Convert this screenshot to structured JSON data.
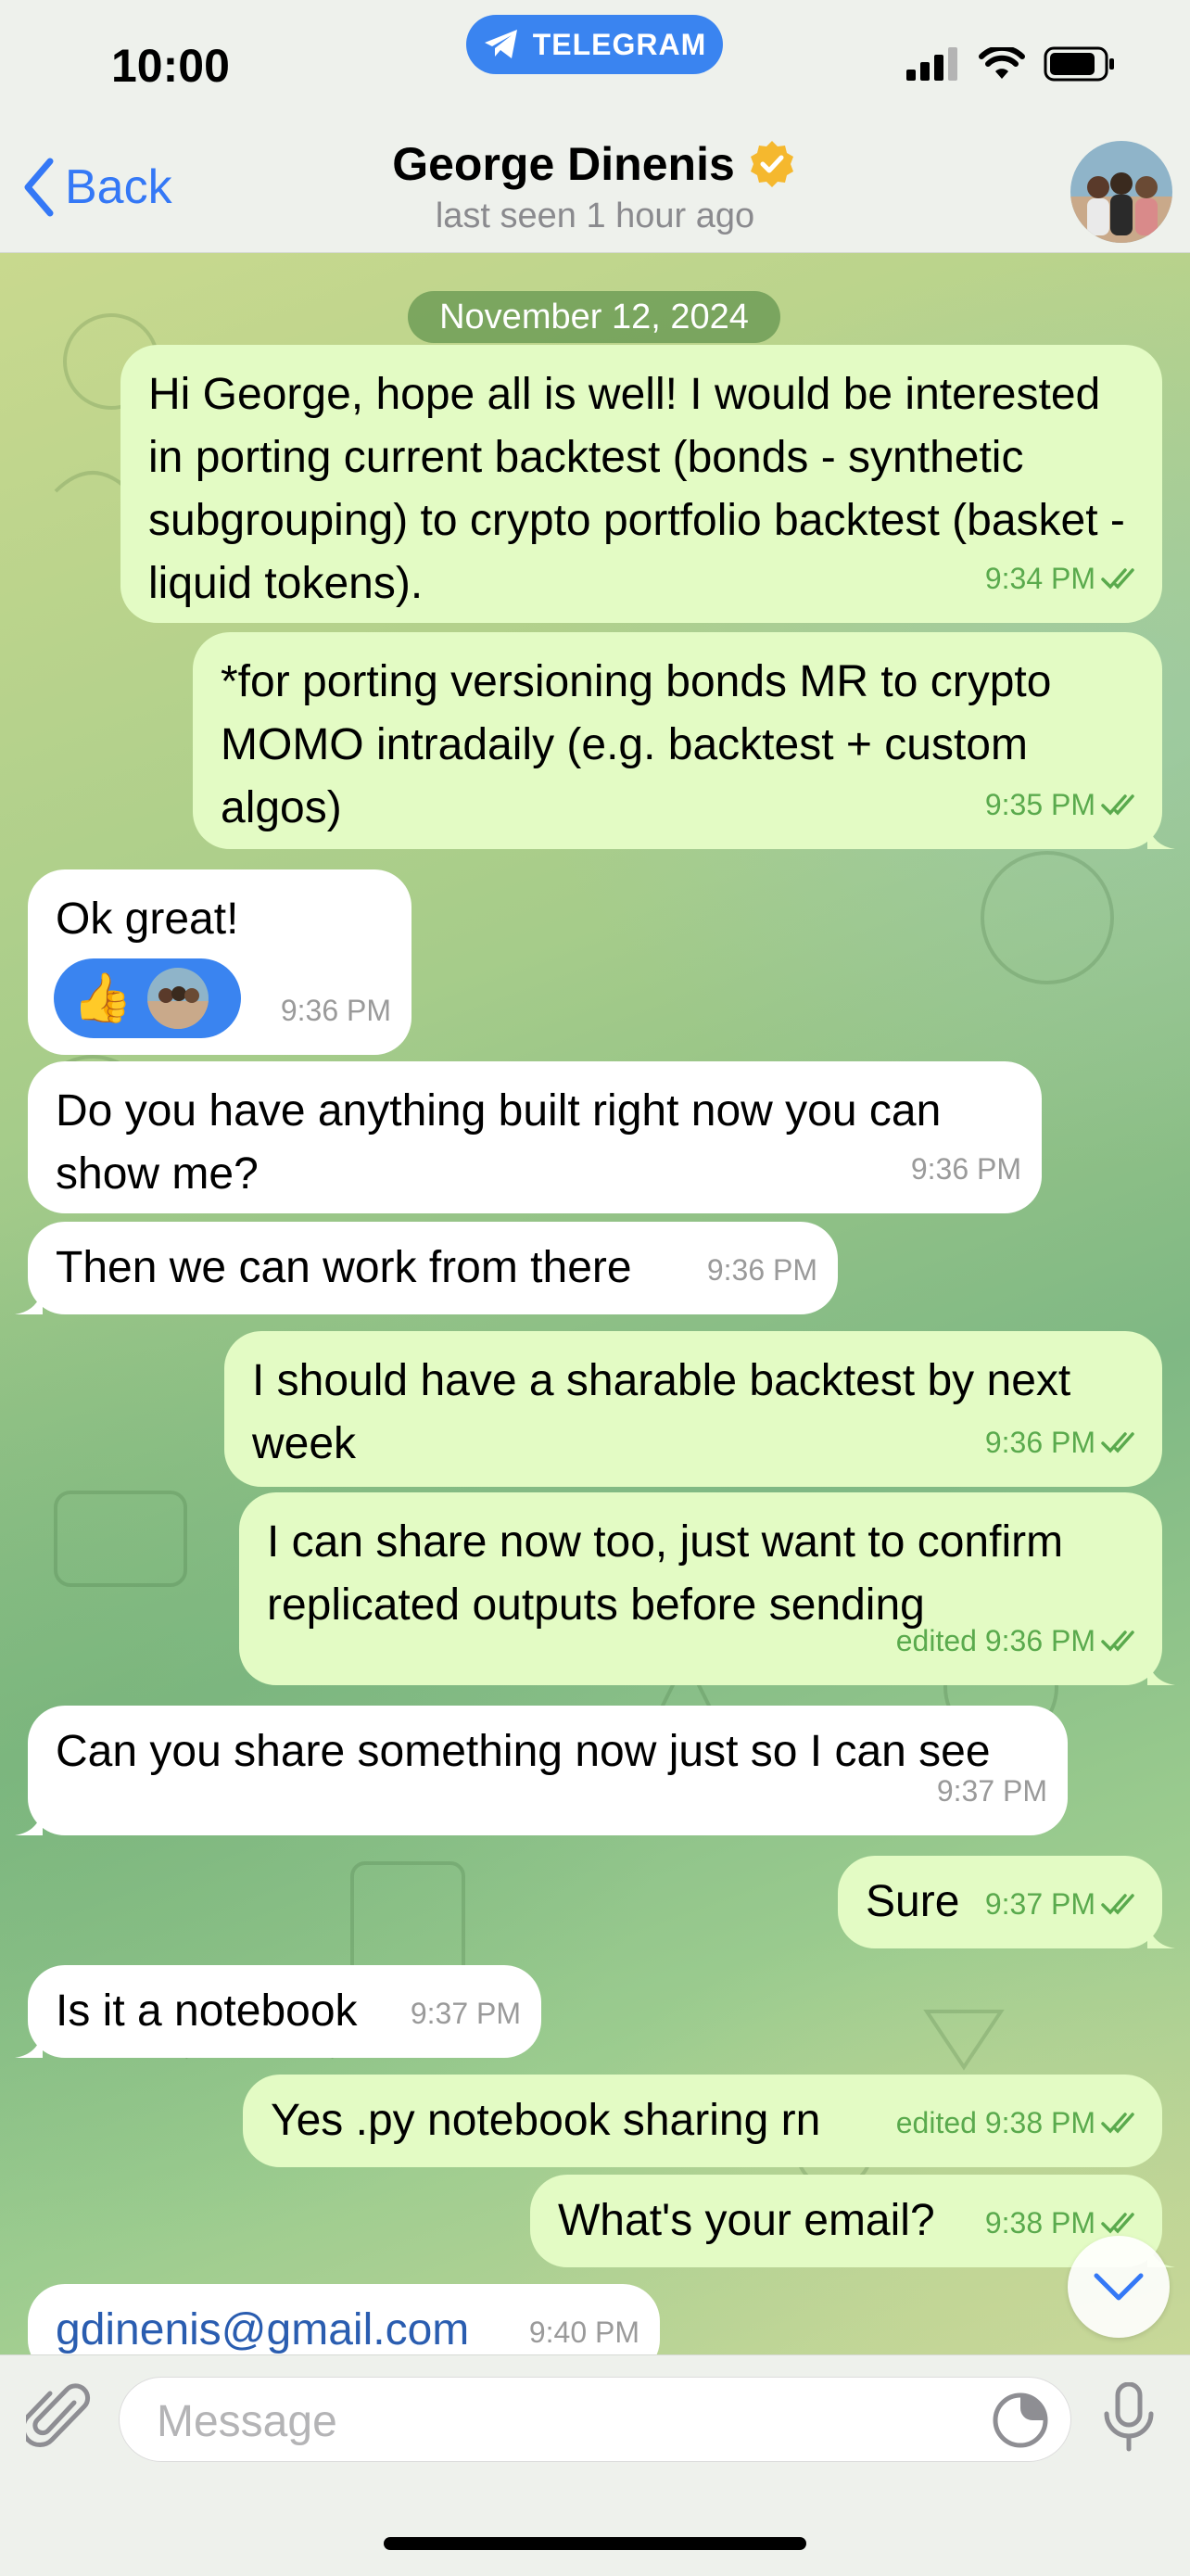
{
  "status_bar": {
    "time": "10:00",
    "pill_label": "TELEGRAM"
  },
  "header": {
    "back_label": "Back",
    "contact_name": "George Dinenis",
    "last_seen": "last seen 1 hour ago"
  },
  "date_separator": "November 12, 2024",
  "messages": [
    {
      "direction": "out",
      "text": "Hi George, hope all is well! I would be interested in porting current backtest (bonds - synthetic subgrouping) to crypto portfolio backtest (basket - liquid tokens).",
      "time": "9:34 PM"
    },
    {
      "direction": "out",
      "text": "*for porting versioning bonds MR to crypto MOMO intradaily (e.g. backtest + custom algos)",
      "time": "9:35 PM"
    },
    {
      "direction": "in",
      "text": "Ok great!",
      "time": "9:36 PM",
      "reaction": "👍"
    },
    {
      "direction": "in",
      "text": "Do you have anything built right now you can show me?",
      "time": "9:36 PM"
    },
    {
      "direction": "in",
      "text": "Then we can work from there",
      "time": "9:36 PM"
    },
    {
      "direction": "out",
      "text": "I should have a sharable backtest by next week",
      "time": "9:36 PM"
    },
    {
      "direction": "out",
      "text": "I can share now too, just want to confirm replicated outputs before sending",
      "time": "edited 9:36 PM"
    },
    {
      "direction": "in",
      "text": "Can you share something now just so I can see",
      "time": "9:37 PM"
    },
    {
      "direction": "out",
      "text": "Sure",
      "time": "9:37 PM"
    },
    {
      "direction": "in",
      "text": "Is it a notebook",
      "time": "9:37 PM"
    },
    {
      "direction": "out",
      "text": "Yes .py notebook sharing rn",
      "time": "edited 9:38 PM"
    },
    {
      "direction": "out",
      "text": "What's your email?",
      "time": "9:38 PM"
    },
    {
      "direction": "in",
      "text": "gdinenis@gmail.com",
      "time": "9:40 PM"
    }
  ],
  "composer": {
    "placeholder": "Message"
  },
  "colors": {
    "accent": "#3478f6",
    "outgoing_bubble": "#e3fbc4",
    "incoming_bubble": "#ffffff",
    "check": "#5aaa4d"
  },
  "icons": [
    "telegram-icon",
    "signal-icon",
    "wifi-icon",
    "battery-icon",
    "chevron-left-icon",
    "verified-badge-icon",
    "double-check-icon",
    "chevron-down-icon",
    "paperclip-icon",
    "sticker-icon",
    "microphone-icon"
  ]
}
